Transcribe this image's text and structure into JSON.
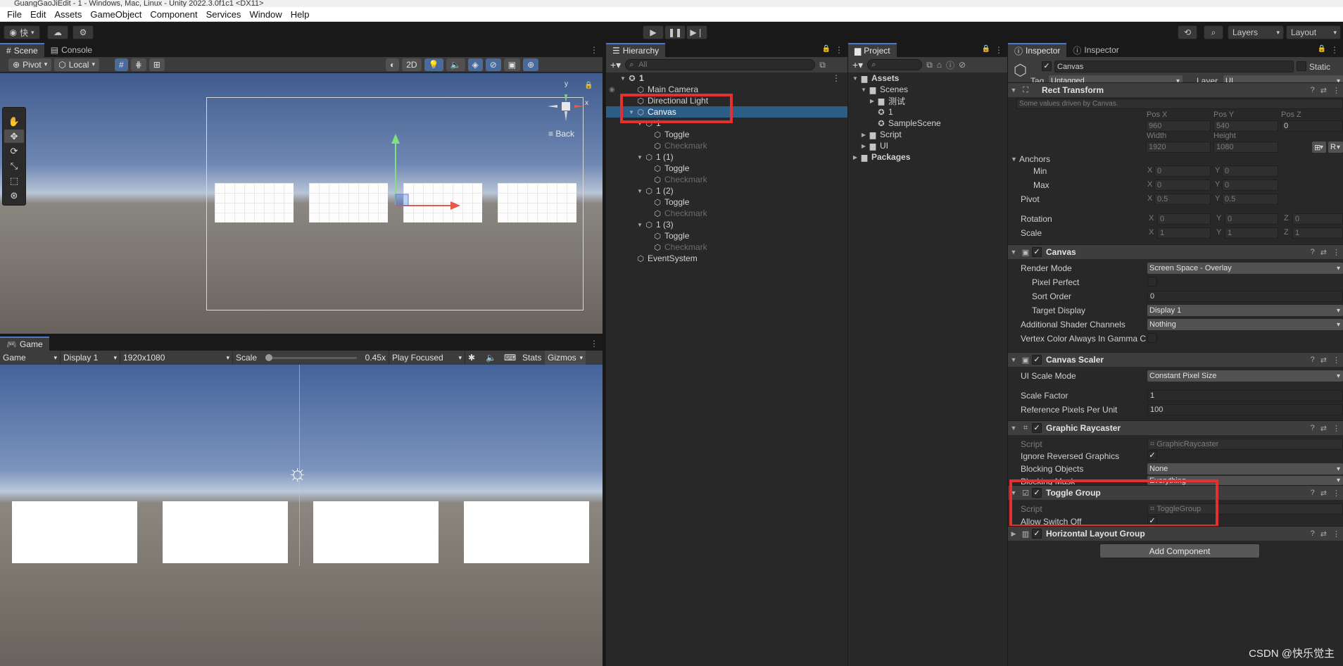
{
  "window": {
    "title": "GuangGaoJiEdit - 1 - Windows, Mac, Linux - Unity 2022.3.0f1c1 <DX11>"
  },
  "menu": [
    "File",
    "Edit",
    "Assets",
    "GameObject",
    "Component",
    "Services",
    "Window",
    "Help"
  ],
  "toolbar": {
    "account": "快",
    "layers": "Layers",
    "layout": "Layout"
  },
  "scene": {
    "tabs": [
      "Scene",
      "Console"
    ],
    "pivot": "Pivot",
    "local": "Local",
    "mode2d": "2D",
    "back_label": "Back",
    "gizmo_y": "y",
    "gizmo_x": "x"
  },
  "game": {
    "tab": "Game",
    "display_mode": "Game",
    "display": "Display 1",
    "resolution": "1920x1080",
    "scale_label": "Scale",
    "scale_value": "0.45x",
    "scale_fraction": 0.45,
    "play_mode": "Play Focused",
    "stats": "Stats",
    "gizmos": "Gizmos"
  },
  "hierarchy": {
    "tab": "Hierarchy",
    "search_placeholder": "All",
    "items": [
      {
        "label": "1",
        "depth": 0,
        "icon": "scene-icon",
        "state": "normal"
      },
      {
        "label": "Main Camera",
        "depth": 1,
        "icon": "cube-icon",
        "state": "normal"
      },
      {
        "label": "Directional Light",
        "depth": 1,
        "icon": "cube-icon",
        "state": "normal"
      },
      {
        "label": "Canvas",
        "depth": 1,
        "icon": "cube-icon",
        "state": "selected"
      },
      {
        "label": "1",
        "depth": 2,
        "icon": "cube-icon",
        "state": "normal"
      },
      {
        "label": "Toggle",
        "depth": 3,
        "icon": "cube-icon",
        "state": "normal"
      },
      {
        "label": "Checkmark",
        "depth": 3,
        "icon": "cube-icon",
        "state": "dim"
      },
      {
        "label": "1 (1)",
        "depth": 2,
        "icon": "cube-icon",
        "state": "normal"
      },
      {
        "label": "Toggle",
        "depth": 3,
        "icon": "cube-icon",
        "state": "normal"
      },
      {
        "label": "Checkmark",
        "depth": 3,
        "icon": "cube-icon",
        "state": "dim"
      },
      {
        "label": "1 (2)",
        "depth": 2,
        "icon": "cube-icon",
        "state": "normal"
      },
      {
        "label": "Toggle",
        "depth": 3,
        "icon": "cube-icon",
        "state": "normal"
      },
      {
        "label": "Checkmark",
        "depth": 3,
        "icon": "cube-icon",
        "state": "dim"
      },
      {
        "label": "1 (3)",
        "depth": 2,
        "icon": "cube-icon",
        "state": "normal"
      },
      {
        "label": "Toggle",
        "depth": 3,
        "icon": "cube-icon",
        "state": "normal"
      },
      {
        "label": "Checkmark",
        "depth": 3,
        "icon": "cube-icon",
        "state": "dim"
      },
      {
        "label": "EventSystem",
        "depth": 1,
        "icon": "cube-icon",
        "state": "normal"
      }
    ]
  },
  "project": {
    "tab": "Project",
    "items": [
      {
        "label": "Assets",
        "depth": 0,
        "bold": true
      },
      {
        "label": "Scenes",
        "depth": 1
      },
      {
        "label": "测试",
        "depth": 2
      },
      {
        "label": "1",
        "depth": 2
      },
      {
        "label": "SampleScene",
        "depth": 2
      },
      {
        "label": "Script",
        "depth": 1
      },
      {
        "label": "UI",
        "depth": 1
      },
      {
        "label": "Packages",
        "depth": 0,
        "bold": true
      }
    ]
  },
  "inspector": {
    "tabs": [
      "Inspector",
      "Inspector"
    ],
    "object_name": "Canvas",
    "static_label": "Static",
    "tag_label": "Tag",
    "tag_value": "Untagged",
    "layer_label": "Layer",
    "layer_value": "UI",
    "rect_transform": {
      "title": "Rect Transform",
      "note": "Some values driven by Canvas.",
      "pos_x_label": "Pos X",
      "pos_y_label": "Pos Y",
      "pos_z_label": "Pos Z",
      "pos_x": "960",
      "pos_y": "540",
      "pos_z": "0",
      "width_label": "Width",
      "height_label": "Height",
      "width": "1920",
      "height": "1080",
      "r_button": "R",
      "anchors": "Anchors",
      "min": "Min",
      "max": "Max",
      "min_x": "0",
      "min_y": "0",
      "max_x": "0",
      "max_y": "0",
      "pivot": "Pivot",
      "pivot_x": "0.5",
      "pivot_y": "0.5",
      "rotation": "Rotation",
      "rot_x": "0",
      "rot_y": "0",
      "rot_z": "0",
      "scale": "Scale",
      "scale_x": "1",
      "scale_y": "1",
      "scale_z": "1",
      "axis_x": "X",
      "axis_y": "Y",
      "axis_z": "Z"
    },
    "canvas": {
      "title": "Canvas",
      "render_mode_label": "Render Mode",
      "render_mode": "Screen Space - Overlay",
      "pixel_perfect": "Pixel Perfect",
      "sort_order_label": "Sort Order",
      "sort_order": "0",
      "target_display_label": "Target Display",
      "target_display": "Display 1",
      "shader_channels_label": "Additional Shader Channels",
      "shader_channels": "Nothing",
      "vertex_color_label": "Vertex Color Always In Gamma C"
    },
    "canvas_scaler": {
      "title": "Canvas Scaler",
      "ui_scale_mode_label": "UI Scale Mode",
      "ui_scale_mode": "Constant Pixel Size",
      "scale_factor_label": "Scale Factor",
      "scale_factor": "1",
      "ref_ppu_label": "Reference Pixels Per Unit",
      "ref_ppu": "100"
    },
    "graphic_raycaster": {
      "title": "Graphic Raycaster",
      "script_label": "Script",
      "script": "GraphicRaycaster",
      "ignore_reversed_label": "Ignore Reversed Graphics",
      "blocking_objects_label": "Blocking Objects",
      "blocking_objects": "None",
      "blocking_mask_label": "Blocking Mask",
      "blocking_mask": "Everything"
    },
    "toggle_group": {
      "title": "Toggle Group",
      "script_label": "Script",
      "script": "ToggleGroup",
      "allow_switch_off_label": "Allow Switch Off"
    },
    "horizontal_layout": {
      "title": "Horizontal Layout Group"
    },
    "add_component": "Add Component"
  },
  "watermark": "CSDN @快乐觉主",
  "colors": {
    "accent": "#4d78cc",
    "selection": "#2c5d87",
    "highlight": "#e53030"
  }
}
